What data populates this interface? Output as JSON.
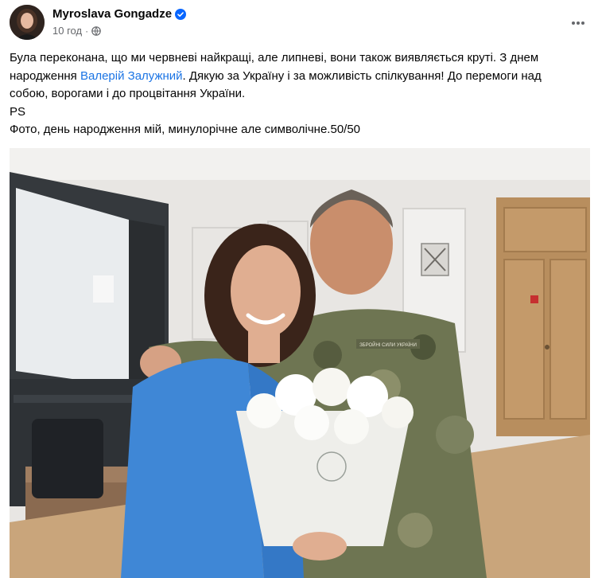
{
  "post": {
    "author": "Myroslava Gongadze",
    "time": "10 год",
    "dot": "·",
    "text": {
      "line1": "Була переконана,  що ми червневі найкращі, але липневі, вони також виявляється круті. З днем народження ",
      "mention": "Валерій Залужний",
      "line1_tail": ". Дякую за Україну і за можливість спілкування! До перемоги над собою, ворогами і до процвітання України.",
      "ps": "PS",
      "line3": "Фото, день народження мій, минулорічне але символічне.50/50"
    },
    "photo": {
      "uniform_tag": "ЗБРОЙНІ СИЛИ УКРАЇНИ"
    }
  },
  "colors": {
    "link": "#1b74e4",
    "verified": "#0866ff",
    "meta": "#65676b"
  },
  "icons": {
    "verified": "verified-badge-icon",
    "audience": "globe-icon",
    "more": "more-options-icon"
  }
}
